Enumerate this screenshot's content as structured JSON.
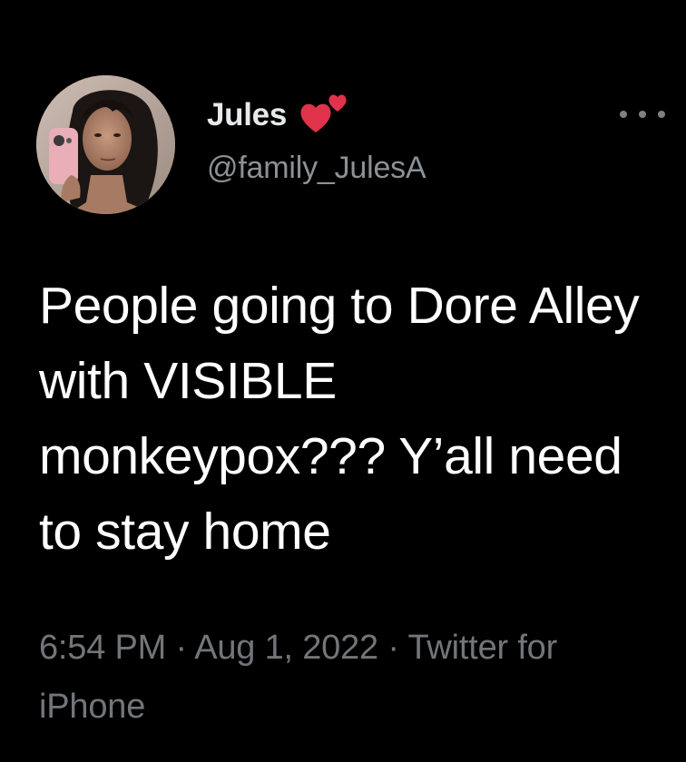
{
  "author": {
    "display_name": "Jules",
    "handle": "@family_JulesA",
    "name_emoji_icon": "two-hearts-icon",
    "avatar_icon": "profile-photo"
  },
  "more_icon": "more-horizontal-icon",
  "tweet": {
    "text": "People going to Dore Alley with VISIBLE monkeypox??? Y’all need to stay home"
  },
  "meta": {
    "time": "6:54 PM",
    "separator": "·",
    "date": "Aug 1, 2022",
    "source": "Twitter for iPhone"
  },
  "colors": {
    "background": "#000000",
    "text_primary": "#ffffff",
    "text_secondary": "#72767a",
    "heart": "#e0334b"
  }
}
